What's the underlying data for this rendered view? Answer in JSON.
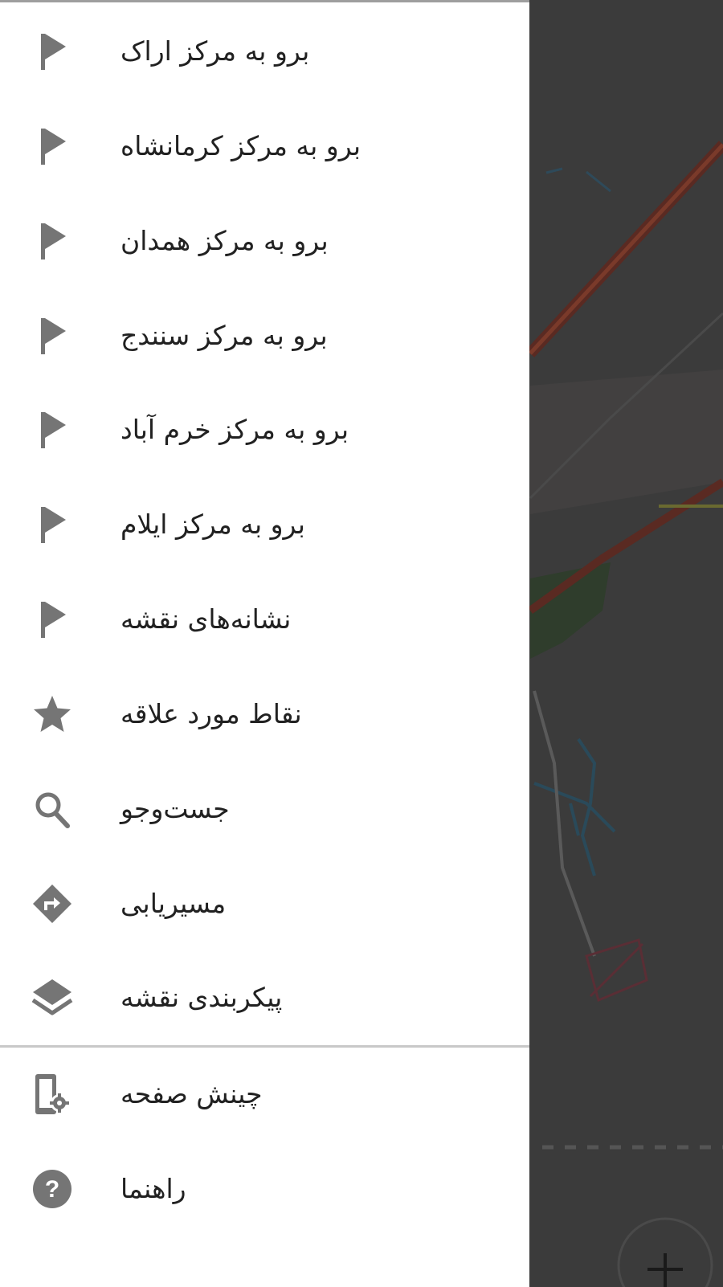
{
  "drawer": {
    "items": [
      {
        "label": "برو به مرکز اراک",
        "icon": "flag-icon"
      },
      {
        "label": "برو به مرکز کرمانشاه",
        "icon": "flag-icon"
      },
      {
        "label": "برو به مرکز همدان",
        "icon": "flag-icon"
      },
      {
        "label": "برو به مرکز سنندج",
        "icon": "flag-icon"
      },
      {
        "label": "برو به مرکز خرم آباد",
        "icon": "flag-icon"
      },
      {
        "label": "برو به مرکز ایلام",
        "icon": "flag-icon"
      },
      {
        "label": "نشانه‌های نقشه",
        "icon": "flag-icon"
      },
      {
        "label": "نقاط مورد علاقه",
        "icon": "star-icon"
      },
      {
        "label": "جست‌وجو",
        "icon": "search-icon"
      },
      {
        "label": "مسیریابی",
        "icon": "directions-icon"
      },
      {
        "label": "پیکربندی نقشه",
        "icon": "layers-icon"
      }
    ],
    "footer_items": [
      {
        "label": "چینش صفحه",
        "icon": "screen-settings-icon"
      },
      {
        "label": "راهنما",
        "icon": "help-icon"
      }
    ]
  },
  "colors": {
    "icon": "#757575",
    "text": "#212121",
    "scrim_map": "#3d3d3d"
  }
}
